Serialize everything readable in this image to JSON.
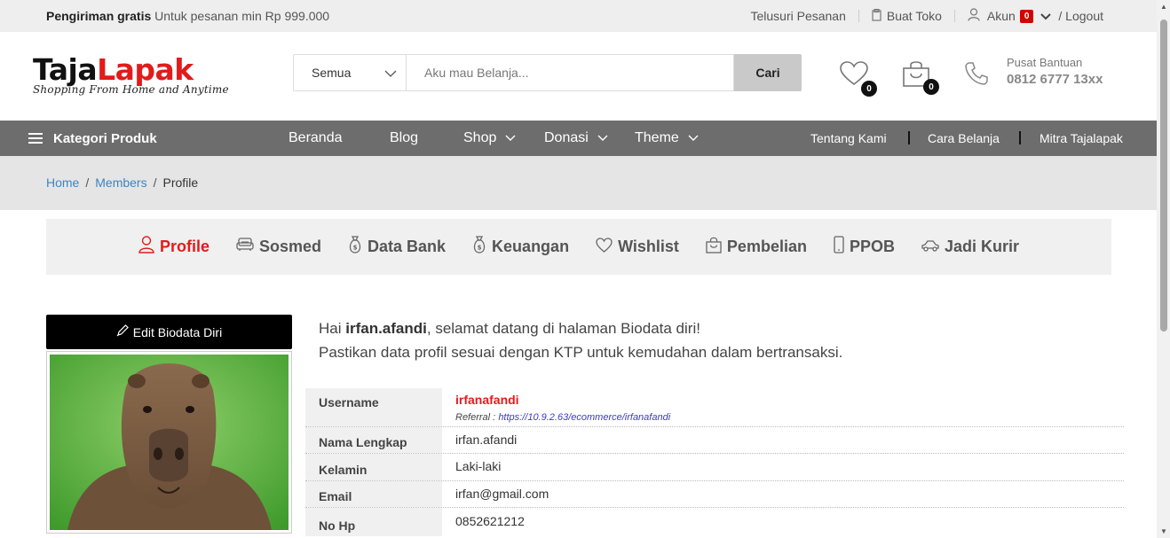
{
  "topbar": {
    "shipping_bold": "Pengiriman gratis",
    "shipping_text": "Untuk pesanan min Rp 999.000",
    "track_order": "Telusuri Pesanan",
    "create_store": "Buat Toko",
    "account": "Akun",
    "account_badge": "0",
    "logout": "/ Logout"
  },
  "header": {
    "logo_part1": "Taja",
    "logo_part2": "Lapak",
    "logo_tagline": "Shopping From Home and Anytime",
    "search_category": "Semua",
    "search_placeholder": "Aku mau Belanja...",
    "search_button": "Cari",
    "wishlist_count": "0",
    "cart_count": "0",
    "help_label": "Pusat Bantuan",
    "help_phone": "0812 6777 13xx"
  },
  "nav": {
    "category_label": "Kategori Produk",
    "items": [
      "Beranda",
      "Blog",
      "Shop",
      "Donasi",
      "Theme"
    ],
    "right_links": [
      "Tentang Kami",
      "Cara Belanja",
      "Mitra Tajalapak"
    ]
  },
  "breadcrumb": {
    "home": "Home",
    "members": "Members",
    "current": "Profile"
  },
  "tabs": [
    {
      "label": "Profile",
      "icon": "user-icon",
      "active": true
    },
    {
      "label": "Sosmed",
      "icon": "sofa-icon",
      "active": false
    },
    {
      "label": "Data Bank",
      "icon": "money-bag-icon",
      "active": false
    },
    {
      "label": "Keuangan",
      "icon": "money-bag-icon",
      "active": false
    },
    {
      "label": "Wishlist",
      "icon": "heart-icon",
      "active": false
    },
    {
      "label": "Pembelian",
      "icon": "shopping-bag-icon",
      "active": false
    },
    {
      "label": "PPOB",
      "icon": "mobile-icon",
      "active": false
    },
    {
      "label": "Jadi Kurir",
      "icon": "car-icon",
      "active": false
    }
  ],
  "sidebar": {
    "edit_button": "Edit Biodata Diri"
  },
  "greeting": {
    "prefix": "Hai",
    "username": "irfan.afandi",
    "suffix": ", selamat datang di halaman Biodata diri!",
    "line2": "Pastikan data profil sesuai dengan KTP untuk kemudahan dalam bertransaksi."
  },
  "profile": {
    "username_label": "Username",
    "username_value": "irfanafandi",
    "referral_label": "Referral :",
    "referral_url": "https://10.9.2.63/ecommerce/irfanafandi",
    "fullname_label": "Nama Lengkap",
    "fullname_value": "irfan.afandi",
    "gender_label": "Kelamin",
    "gender_value": "Laki-laki",
    "email_label": "Email",
    "email_value": "irfan@gmail.com",
    "phone_label": "No Hp",
    "phone_value": "0852621212"
  },
  "colors": {
    "accent_red": "#e31b1b",
    "nav_bg": "#6d6d6d",
    "link_blue": "#3a86c8"
  }
}
